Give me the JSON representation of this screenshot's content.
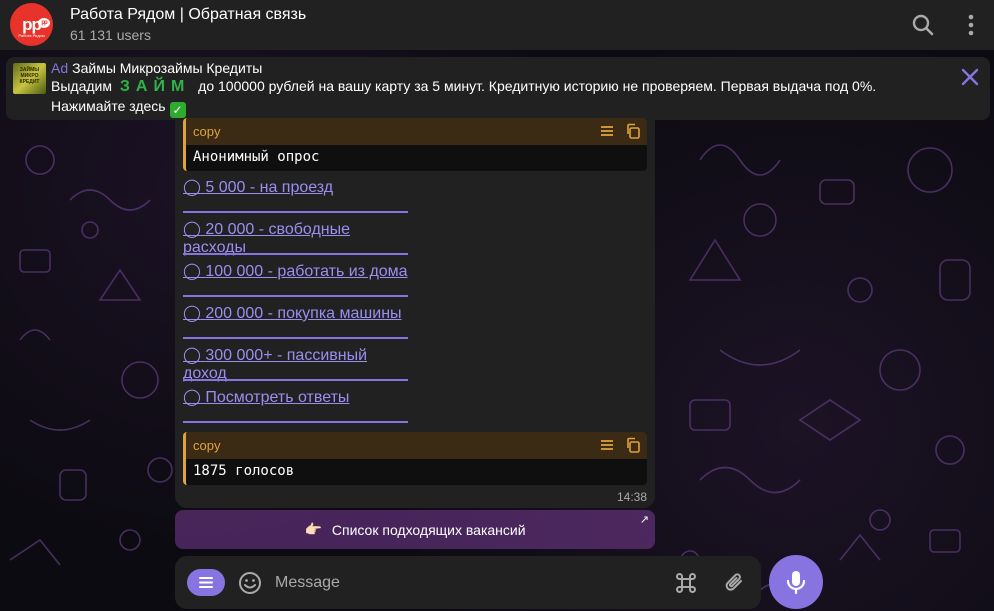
{
  "header": {
    "title": "Работа Рядом | Обратная связь",
    "subtitle": "61 131 users",
    "avatar_text": "pp",
    "avatar_subtext": "Работа Рядом",
    "avatar_badge": "pp"
  },
  "ad": {
    "tag": "Ad",
    "title": "Займы Микрозаймы Кредиты",
    "line_prefix": "Выдадим",
    "zaim": "ЗАЙМ",
    "line_suffix": "до 100000 рублей на вашу карту за 5 минут. Кредитную историю не проверяем. Первая выдача под 0%.",
    "line3": "Нажимайте здесь",
    "check": "✓",
    "thumb_text": "ЗАЙМЫ МИКРО КРЕДИТ"
  },
  "message": {
    "code1_label": "copy",
    "code1_text": "Анонимный опрос",
    "poll_marker": "◯",
    "poll_items": [
      "5 000 - на проезд",
      "20 000 - свободные расходы",
      "100 000 - работать из дома",
      "200 000 - покупка машины",
      "300 000+ - пассивный доход",
      "Посмотреть ответы"
    ],
    "code2_label": "copy",
    "code2_text": "1875 голосов",
    "time": "14:38"
  },
  "keyboard": {
    "emoji": "👉🏻",
    "button_label": "Список подходящих вакансий",
    "arrow": "↗"
  },
  "composer": {
    "placeholder": "Message"
  },
  "colors": {
    "accent": "#8774e1",
    "code_border": "#e0a33c",
    "header_bg": "#212121",
    "zaim_green": "#2fb34a"
  }
}
